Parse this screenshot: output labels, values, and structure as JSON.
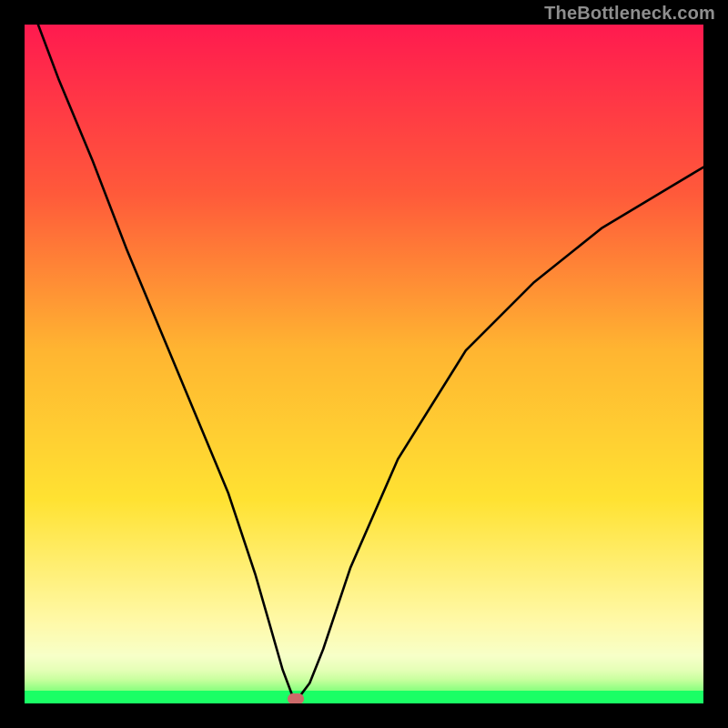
{
  "attribution": "TheBottleneck.com",
  "chart_data": {
    "type": "line",
    "title": "",
    "xlabel": "",
    "ylabel": "",
    "xlim": [
      0,
      100
    ],
    "ylim": [
      0,
      100
    ],
    "grid": false,
    "legend": false,
    "series": [
      {
        "name": "bottleneck-curve",
        "x": [
          2,
          5,
          10,
          15,
          20,
          25,
          30,
          34,
          36,
          38,
          39.5,
          40.5,
          42,
          44,
          48,
          55,
          65,
          75,
          85,
          95,
          100
        ],
        "y": [
          100,
          92,
          80,
          67,
          55,
          43,
          31,
          19,
          12,
          5,
          1,
          1,
          3,
          8,
          20,
          36,
          52,
          62,
          70,
          76,
          79
        ]
      }
    ],
    "marker": {
      "x": 40,
      "y": 0.5
    },
    "gradient_stops": [
      {
        "pos": 0.0,
        "color": "#ff1a4f"
      },
      {
        "pos": 0.25,
        "color": "#ff5a3a"
      },
      {
        "pos": 0.48,
        "color": "#ffb531"
      },
      {
        "pos": 0.7,
        "color": "#ffe232"
      },
      {
        "pos": 0.88,
        "color": "#fff9a8"
      },
      {
        "pos": 0.98,
        "color": "#8dff80"
      },
      {
        "pos": 1.0,
        "color": "#1aff65"
      }
    ],
    "colors": {
      "curve": "#000000",
      "marker": "#cc6a6a",
      "frame": "#000000"
    }
  }
}
